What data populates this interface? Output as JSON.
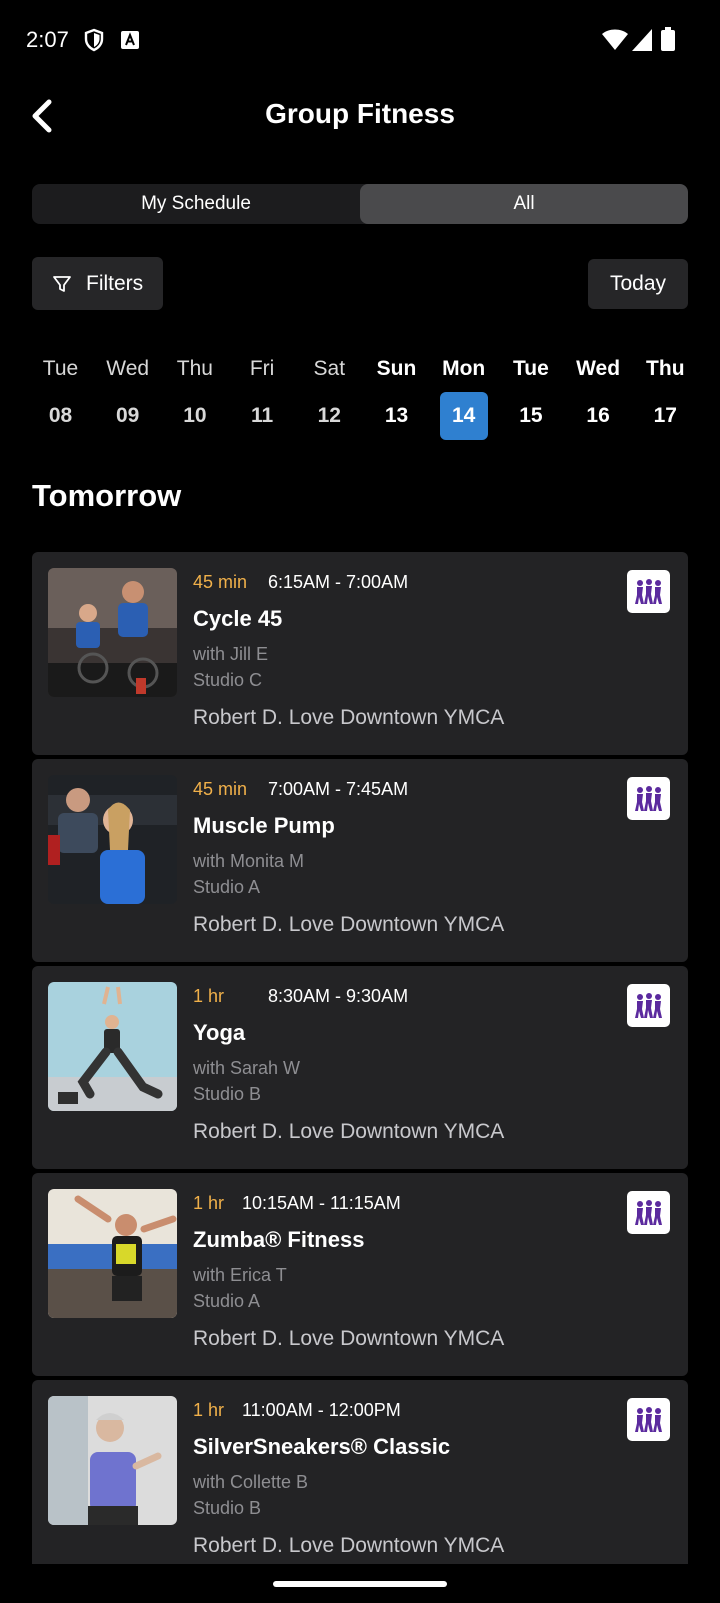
{
  "status_bar": {
    "time": "2:07"
  },
  "header": {
    "title": "Group Fitness"
  },
  "tabs": [
    {
      "label": "My Schedule",
      "active": false
    },
    {
      "label": "All",
      "active": true
    }
  ],
  "toolbar": {
    "filters_label": "Filters",
    "today_label": "Today"
  },
  "dates": [
    {
      "dow": "Tue",
      "dom": "08",
      "state": "past"
    },
    {
      "dow": "Wed",
      "dom": "09",
      "state": "past"
    },
    {
      "dow": "Thu",
      "dom": "10",
      "state": "past"
    },
    {
      "dow": "Fri",
      "dom": "11",
      "state": "past"
    },
    {
      "dow": "Sat",
      "dom": "12",
      "state": "past"
    },
    {
      "dow": "Sun",
      "dom": "13",
      "state": "future"
    },
    {
      "dow": "Mon",
      "dom": "14",
      "state": "selected"
    },
    {
      "dow": "Tue",
      "dom": "15",
      "state": "future"
    },
    {
      "dow": "Wed",
      "dom": "16",
      "state": "future"
    },
    {
      "dow": "Thu",
      "dom": "17",
      "state": "future"
    }
  ],
  "section_heading": "Tomorrow",
  "classes": [
    {
      "duration": "45 min",
      "time": "6:15AM - 7:00AM",
      "name": "Cycle 45",
      "instructor": "with Jill E",
      "studio": "Studio C",
      "location": "Robert D. Love Downtown YMCA",
      "category_icon": "group-dance-icon"
    },
    {
      "duration": "45 min",
      "time": "7:00AM - 7:45AM",
      "name": "Muscle Pump",
      "instructor": "with Monita M",
      "studio": "Studio A",
      "location": "Robert D. Love Downtown YMCA",
      "category_icon": "group-dance-icon"
    },
    {
      "duration": "1 hr",
      "time": "8:30AM - 9:30AM",
      "name": "Yoga",
      "instructor": "with Sarah W",
      "studio": "Studio B",
      "location": "Robert D. Love Downtown YMCA",
      "category_icon": "group-dance-icon"
    },
    {
      "duration": "1 hr",
      "time": "10:15AM - 11:15AM",
      "name": "Zumba® Fitness",
      "instructor": "with Erica T",
      "studio": "Studio A",
      "location": "Robert D. Love Downtown YMCA",
      "category_icon": "group-dance-icon"
    },
    {
      "duration": "1 hr",
      "time": "11:00AM - 12:00PM",
      "name": "SilverSneakers® Classic",
      "instructor": "with Collette B",
      "studio": "Studio B",
      "location": "Robert D. Love Downtown YMCA",
      "category_icon": "group-dance-icon"
    }
  ],
  "colors": {
    "accent": "#2f80d0",
    "duration": "#f0b04a",
    "card": "#232325",
    "badge_figure": "#5b2a9e"
  }
}
